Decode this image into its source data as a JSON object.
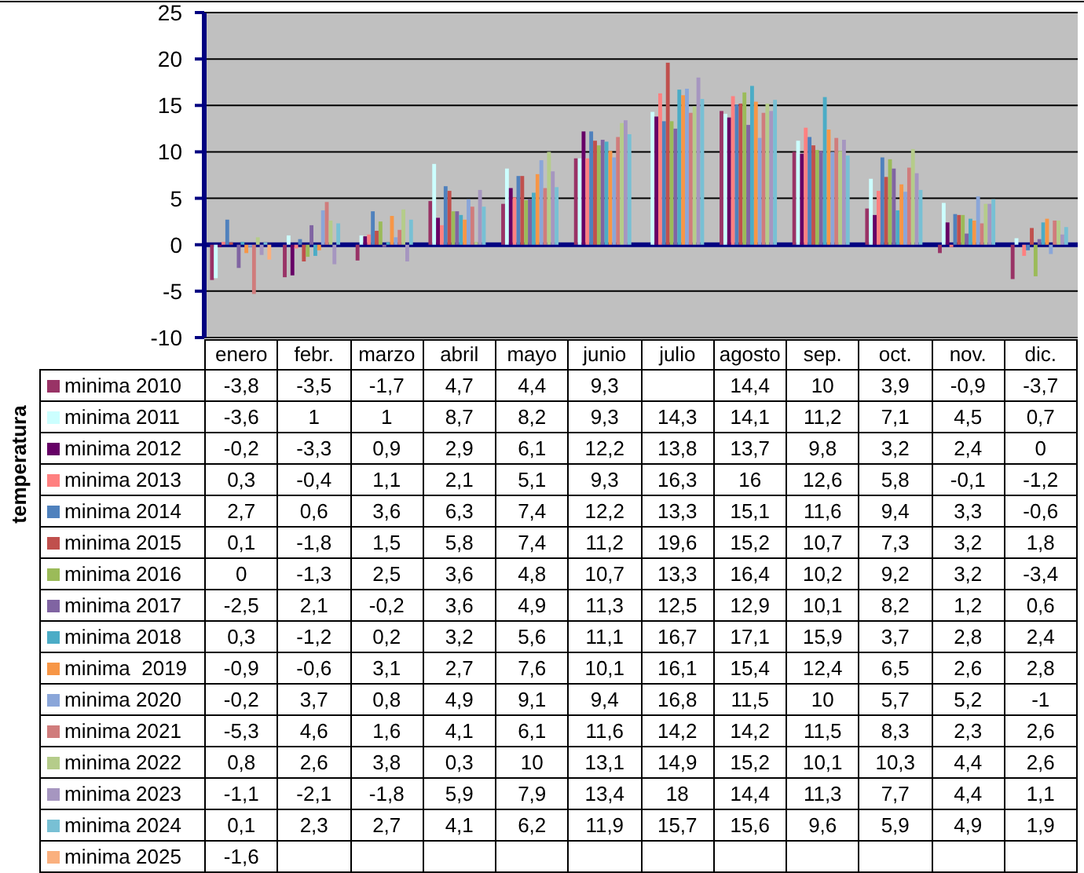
{
  "chart": {
    "y_axis_title": "temperatura",
    "chart_data": {
      "type": "bar",
      "categories": [
        "enero",
        "febr.",
        "marzo",
        "abril",
        "mayo",
        "junio",
        "julio",
        "agosto",
        "sep.",
        "oct.",
        "nov.",
        "dic."
      ],
      "ylim": [
        -10,
        25
      ],
      "grid": true,
      "legend": "left",
      "ref_lines": [
        {
          "axis": "y",
          "value": 0,
          "color": "#000080"
        }
      ],
      "yticks": [
        -10,
        -5,
        0,
        5,
        10,
        15,
        20,
        25
      ],
      "series": [
        {
          "name": "minima 2010",
          "color": "#993366",
          "values": [
            -3.8,
            -3.5,
            -1.7,
            4.7,
            4.4,
            9.3,
            null,
            14.4,
            10,
            3.9,
            -0.9,
            -3.7
          ]
        },
        {
          "name": "minima 2011",
          "color": "#ccffff",
          "values": [
            -3.6,
            1,
            1,
            8.7,
            8.2,
            9.3,
            14.3,
            14.1,
            11.2,
            7.1,
            4.5,
            0.7
          ]
        },
        {
          "name": "minima 2012",
          "color": "#660066",
          "values": [
            -0.2,
            -3.3,
            0.9,
            2.9,
            6.1,
            12.2,
            13.8,
            13.7,
            9.8,
            3.2,
            2.4,
            0
          ]
        },
        {
          "name": "minima 2013",
          "color": "#ff8080",
          "values": [
            0.3,
            -0.4,
            1.1,
            2.1,
            5.1,
            9.3,
            16.3,
            16,
            12.6,
            5.8,
            -0.1,
            -1.2
          ]
        },
        {
          "name": "minima 2014",
          "color": "#4f81bd",
          "values": [
            2.7,
            0.6,
            3.6,
            6.3,
            7.4,
            12.2,
            13.3,
            15.1,
            11.6,
            9.4,
            3.3,
            -0.6
          ]
        },
        {
          "name": "minima 2015",
          "color": "#c0504d",
          "values": [
            0.1,
            -1.8,
            1.5,
            5.8,
            7.4,
            11.2,
            19.6,
            15.2,
            10.7,
            7.3,
            3.2,
            1.8
          ]
        },
        {
          "name": "minima 2016",
          "color": "#9bbb59",
          "values": [
            0,
            -1.3,
            2.5,
            3.6,
            4.8,
            10.7,
            13.3,
            16.4,
            10.2,
            9.2,
            3.2,
            -3.4
          ]
        },
        {
          "name": "minima 2017",
          "color": "#8064a2",
          "values": [
            -2.5,
            2.1,
            -0.2,
            3.6,
            4.9,
            11.3,
            12.5,
            12.9,
            10.1,
            8.2,
            1.2,
            0.6
          ]
        },
        {
          "name": "minima 2018",
          "color": "#4bacc6",
          "values": [
            0.3,
            -1.2,
            0.2,
            3.2,
            5.6,
            11.1,
            16.7,
            17.1,
            15.9,
            3.7,
            2.8,
            2.4
          ]
        },
        {
          "name": "minima  2019",
          "color": "#f79646",
          "values": [
            -0.9,
            -0.6,
            3.1,
            2.7,
            7.6,
            10.1,
            16.1,
            15.4,
            12.4,
            6.5,
            2.6,
            2.8
          ]
        },
        {
          "name": "minima 2020",
          "color": "#8aa6d9",
          "values": [
            -0.2,
            3.7,
            0.8,
            4.9,
            9.1,
            9.4,
            16.8,
            11.5,
            10,
            5.7,
            5.2,
            -1
          ]
        },
        {
          "name": "minima 2021",
          "color": "#d07c7c",
          "values": [
            -5.3,
            4.6,
            1.6,
            4.1,
            6.1,
            11.6,
            14.2,
            14.2,
            11.5,
            8.3,
            2.3,
            2.6
          ]
        },
        {
          "name": "minima 2022",
          "color": "#b5cc8a",
          "values": [
            0.8,
            2.6,
            3.8,
            0.3,
            10,
            13.1,
            14.9,
            15.2,
            10.1,
            10.3,
            4.4,
            2.6
          ]
        },
        {
          "name": "minima 2023",
          "color": "#a696c0",
          "values": [
            -1.1,
            -2.1,
            -1.8,
            5.9,
            7.9,
            13.4,
            18,
            14.4,
            11.3,
            7.7,
            4.4,
            1.1
          ]
        },
        {
          "name": "minima 2024",
          "color": "#78c0d4",
          "values": [
            0.1,
            2.3,
            2.7,
            4.1,
            6.2,
            11.9,
            15.7,
            15.6,
            9.6,
            5.9,
            4.9,
            1.9
          ]
        },
        {
          "name": "minima 2025",
          "color": "#fab07e",
          "values": [
            -1.6,
            null,
            null,
            null,
            null,
            null,
            null,
            null,
            null,
            null,
            null,
            null
          ]
        }
      ]
    }
  },
  "y_axis_labels": [
    "25",
    "20",
    "15",
    "10",
    "5",
    "0",
    "-5",
    "-10"
  ],
  "data_table": {
    "rows": [
      {
        "cells": [
          "-3,8",
          "-3,5",
          "-1,7",
          "4,7",
          "4,4",
          "9,3",
          null,
          "14,4",
          "10",
          "3,9",
          "-0,9",
          "-3,7"
        ]
      },
      {
        "cells": [
          "-3,6",
          "1",
          "1",
          "8,7",
          "8,2",
          "9,3",
          "14,3",
          "14,1",
          "11,2",
          "7,1",
          "4,5",
          "0,7"
        ]
      },
      {
        "cells": [
          "-0,2",
          "-3,3",
          "0,9",
          "2,9",
          "6,1",
          "12,2",
          "13,8",
          "13,7",
          "9,8",
          "3,2",
          "2,4",
          "0"
        ]
      },
      {
        "cells": [
          "0,3",
          "-0,4",
          "1,1",
          "2,1",
          "5,1",
          "9,3",
          "16,3",
          "16",
          "12,6",
          "5,8",
          "-0,1",
          "-1,2"
        ]
      },
      {
        "cells": [
          "2,7",
          "0,6",
          "3,6",
          "6,3",
          "7,4",
          "12,2",
          "13,3",
          "15,1",
          "11,6",
          "9,4",
          "3,3",
          "-0,6"
        ]
      },
      {
        "cells": [
          "0,1",
          "-1,8",
          "1,5",
          "5,8",
          "7,4",
          "11,2",
          "19,6",
          "15,2",
          "10,7",
          "7,3",
          "3,2",
          "1,8"
        ]
      },
      {
        "cells": [
          "0",
          "-1,3",
          "2,5",
          "3,6",
          "4,8",
          "10,7",
          "13,3",
          "16,4",
          "10,2",
          "9,2",
          "3,2",
          "-3,4"
        ]
      },
      {
        "cells": [
          "-2,5",
          "2,1",
          "-0,2",
          "3,6",
          "4,9",
          "11,3",
          "12,5",
          "12,9",
          "10,1",
          "8,2",
          "1,2",
          "0,6"
        ]
      },
      {
        "cells": [
          "0,3",
          "-1,2",
          "0,2",
          "3,2",
          "5,6",
          "11,1",
          "16,7",
          "17,1",
          "15,9",
          "3,7",
          "2,8",
          "2,4"
        ]
      },
      {
        "cells": [
          "-0,9",
          "-0,6",
          "3,1",
          "2,7",
          "7,6",
          "10,1",
          "16,1",
          "15,4",
          "12,4",
          "6,5",
          "2,6",
          "2,8"
        ]
      },
      {
        "cells": [
          "-0,2",
          "3,7",
          "0,8",
          "4,9",
          "9,1",
          "9,4",
          "16,8",
          "11,5",
          "10",
          "5,7",
          "5,2",
          "-1"
        ]
      },
      {
        "cells": [
          "-5,3",
          "4,6",
          "1,6",
          "4,1",
          "6,1",
          "11,6",
          "14,2",
          "14,2",
          "11,5",
          "8,3",
          "2,3",
          "2,6"
        ]
      },
      {
        "cells": [
          "0,8",
          "2,6",
          "3,8",
          "0,3",
          "10",
          "13,1",
          "14,9",
          "15,2",
          "10,1",
          "10,3",
          "4,4",
          "2,6"
        ]
      },
      {
        "cells": [
          "-1,1",
          "-2,1",
          "-1,8",
          "5,9",
          "7,9",
          "13,4",
          "18",
          "14,4",
          "11,3",
          "7,7",
          "4,4",
          "1,1"
        ]
      },
      {
        "cells": [
          "0,1",
          "2,3",
          "2,7",
          "4,1",
          "6,2",
          "11,9",
          "15,7",
          "15,6",
          "9,6",
          "5,9",
          "4,9",
          "1,9"
        ]
      },
      {
        "cells": [
          "-1,6",
          null,
          null,
          null,
          null,
          null,
          null,
          null,
          null,
          null,
          null,
          null
        ]
      }
    ]
  }
}
